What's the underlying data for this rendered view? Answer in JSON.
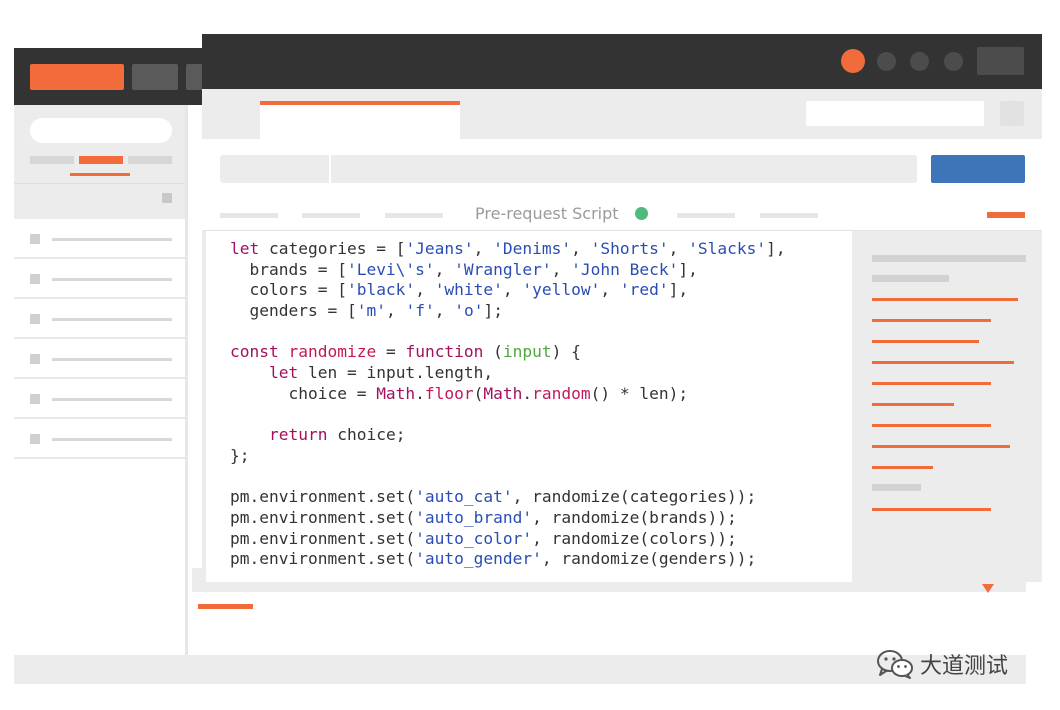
{
  "colors": {
    "accent": "#f26b3a",
    "send_button": "#3e74b8",
    "status_dot": "#4fba7d",
    "title_bar": "#333333"
  },
  "editor": {
    "active_tab_label": "Pre-request Script",
    "lines": [
      [
        {
          "t": "let",
          "c": "kw"
        },
        {
          "t": " categories = ["
        },
        {
          "t": "'Jeans'",
          "c": "str"
        },
        {
          "t": ", "
        },
        {
          "t": "'Denims'",
          "c": "str"
        },
        {
          "t": ", "
        },
        {
          "t": "'Shorts'",
          "c": "str"
        },
        {
          "t": ", "
        },
        {
          "t": "'Slacks'",
          "c": "str"
        },
        {
          "t": "],"
        }
      ],
      [
        {
          "t": "  brands = ["
        },
        {
          "t": "'Levi\\'s'",
          "c": "str"
        },
        {
          "t": ", "
        },
        {
          "t": "'Wrangler'",
          "c": "str"
        },
        {
          "t": ", "
        },
        {
          "t": "'John Beck'",
          "c": "str"
        },
        {
          "t": "],"
        }
      ],
      [
        {
          "t": "  colors = ["
        },
        {
          "t": "'black'",
          "c": "str"
        },
        {
          "t": ", "
        },
        {
          "t": "'white'",
          "c": "str"
        },
        {
          "t": ", "
        },
        {
          "t": "'yellow'",
          "c": "str"
        },
        {
          "t": ", "
        },
        {
          "t": "'red'",
          "c": "str"
        },
        {
          "t": "],"
        }
      ],
      [
        {
          "t": "  genders = ["
        },
        {
          "t": "'m'",
          "c": "str"
        },
        {
          "t": ", "
        },
        {
          "t": "'f'",
          "c": "str"
        },
        {
          "t": ", "
        },
        {
          "t": "'o'",
          "c": "str"
        },
        {
          "t": "];"
        }
      ],
      [],
      [
        {
          "t": "const",
          "c": "kw"
        },
        {
          "t": " "
        },
        {
          "t": "randomize",
          "c": "fn"
        },
        {
          "t": " = "
        },
        {
          "t": "function",
          "c": "kw"
        },
        {
          "t": " ("
        },
        {
          "t": "input",
          "c": "param"
        },
        {
          "t": ") {"
        }
      ],
      [
        {
          "t": "    "
        },
        {
          "t": "let",
          "c": "kw"
        },
        {
          "t": " len = input.length,"
        }
      ],
      [
        {
          "t": "      choice = "
        },
        {
          "t": "Math",
          "c": "obj"
        },
        {
          "t": "."
        },
        {
          "t": "floor",
          "c": "fn"
        },
        {
          "t": "("
        },
        {
          "t": "Math",
          "c": "obj"
        },
        {
          "t": "."
        },
        {
          "t": "random",
          "c": "fn"
        },
        {
          "t": "() * len);"
        }
      ],
      [],
      [
        {
          "t": "    "
        },
        {
          "t": "return",
          "c": "kw"
        },
        {
          "t": " choice;"
        }
      ],
      [
        {
          "t": "};"
        }
      ],
      [],
      [
        {
          "t": "pm.environment.set("
        },
        {
          "t": "'auto_cat'",
          "c": "str"
        },
        {
          "t": ", randomize(categories));"
        }
      ],
      [
        {
          "t": "pm.environment.set("
        },
        {
          "t": "'auto_brand'",
          "c": "str"
        },
        {
          "t": ", randomize(brands));"
        }
      ],
      [
        {
          "t": "pm.environment.set("
        },
        {
          "t": "'auto_color'",
          "c": "str"
        },
        {
          "t": ", randomize(colors));"
        }
      ],
      [
        {
          "t": "pm.environment.set("
        },
        {
          "t": "'auto_gender'",
          "c": "str"
        },
        {
          "t": ", randomize(genders));"
        }
      ]
    ]
  },
  "watermark": {
    "icon": "wechat-icon",
    "text": "大道测试"
  }
}
